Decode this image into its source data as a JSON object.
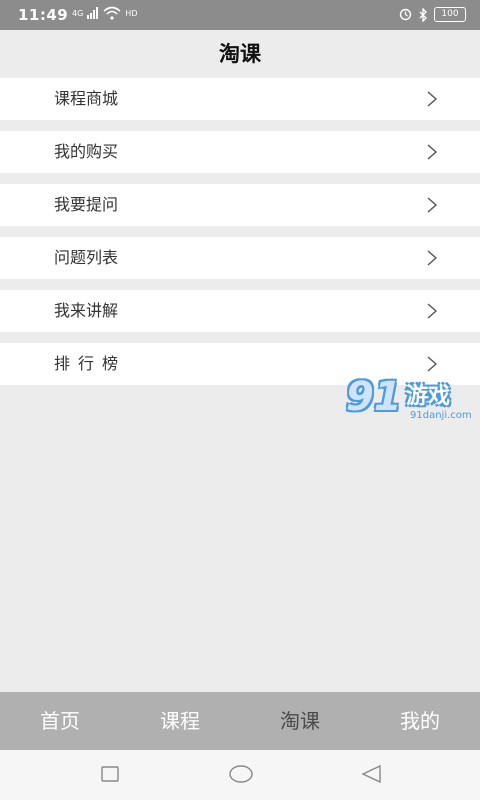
{
  "status_bar": {
    "time": "11:49",
    "net_label": "4G",
    "hd_label": "HD",
    "battery": "100"
  },
  "header": {
    "title": "淘课"
  },
  "menu": {
    "items": [
      {
        "label": "课程商城"
      },
      {
        "label": "我的购买"
      },
      {
        "label": "我要提问"
      },
      {
        "label": "问题列表"
      },
      {
        "label": "我来讲解"
      },
      {
        "label": "排行榜"
      }
    ]
  },
  "watermark": {
    "logo": "91",
    "text": "游戏",
    "sub": "91danji.com"
  },
  "tabs": [
    {
      "label": "首页"
    },
    {
      "label": "课程"
    },
    {
      "label": "淘课"
    },
    {
      "label": "我的"
    }
  ],
  "colors": {
    "status_bar": "#8c8c8c",
    "page_bg": "#ececec",
    "tab_bar": "#b0b0b0",
    "active_tab": "#4a4a4a",
    "watermark_blue": "#4a9be0"
  }
}
